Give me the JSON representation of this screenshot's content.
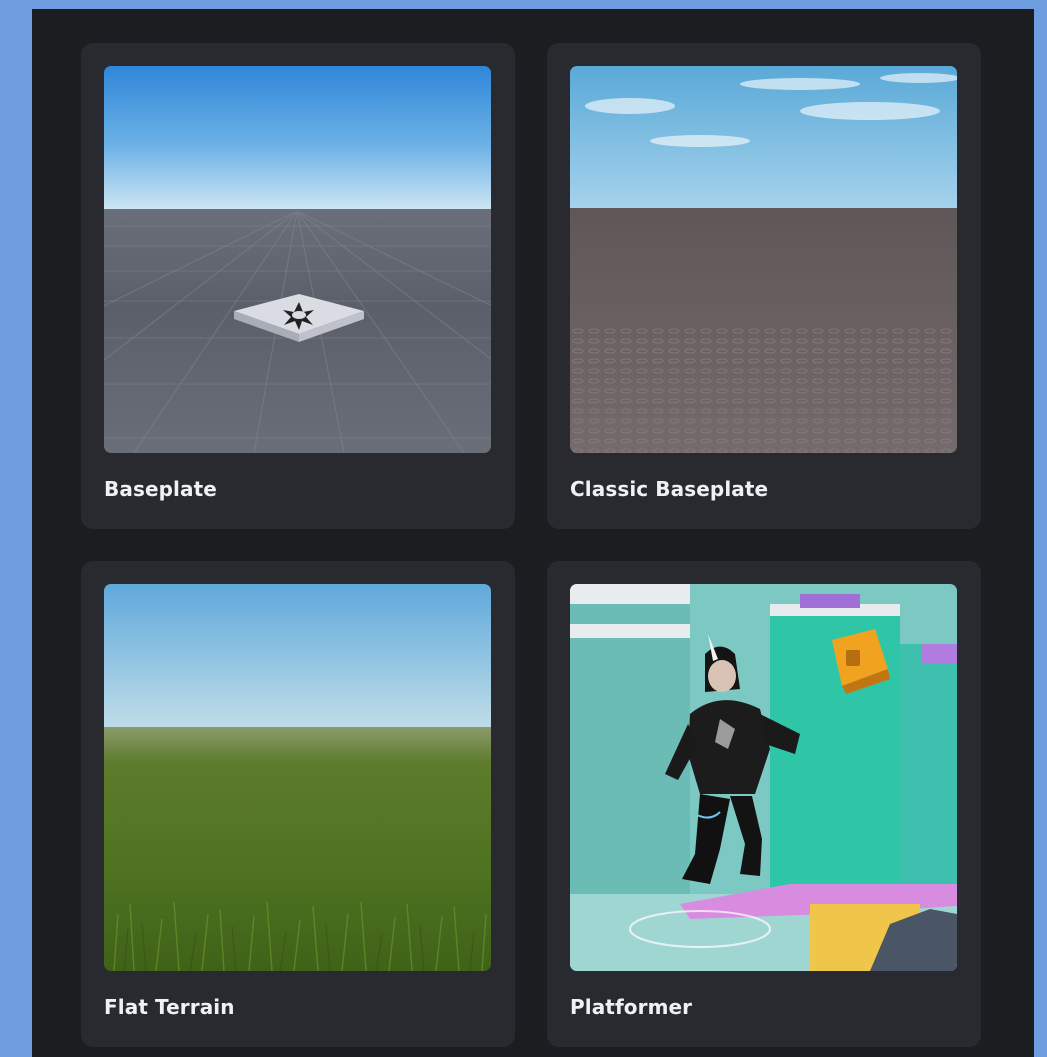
{
  "templates": [
    {
      "title": "Baseplate",
      "scene": "baseplate-scene"
    },
    {
      "title": "Classic Baseplate",
      "scene": "classic-baseplate-scene"
    },
    {
      "title": "Flat Terrain",
      "scene": "flat-terrain-scene"
    },
    {
      "title": "Platformer",
      "scene": "platformer-scene"
    }
  ]
}
